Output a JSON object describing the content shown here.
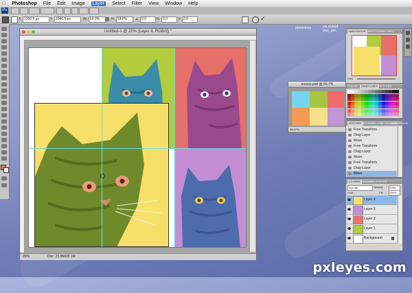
{
  "menubar": {
    "apple_icon": "apple-icon",
    "app": "Photoshop",
    "items": [
      "File",
      "Edit",
      "Image",
      "Layer",
      "Select",
      "Filter",
      "View",
      "Window",
      "Help"
    ],
    "active_item": "Layer"
  },
  "options_bar": {
    "x_value": "1250.5 px",
    "y_value": "2040.5 px",
    "w_value": "64.0%",
    "h_value": "64.0%",
    "angle_value": "0.0",
    "h_skew_value": "0.0",
    "v_skew_value": "0.0"
  },
  "desktop_labels": [
    "photoshop",
    "pw scaled",
    "pw1_stri..."
  ],
  "document": {
    "title": "Untitled-1 @ 25% (Layer 4, RGB/8) *",
    "zoom": "25%",
    "doc_info": "Doc: 25.8M/26.1M"
  },
  "source_window": {
    "title": "source.psd @ 66.7%",
    "zoom": "66.67%",
    "colors": [
      "#78d3f1",
      "#a7c443",
      "#f06a6a",
      "#f49a55",
      "#f5e08b",
      "#c394d6"
    ]
  },
  "navigator": {
    "tabs": [
      "NAVIGATOR",
      "HISTOGRAM",
      "INFO"
    ],
    "zoom": "25%"
  },
  "swatches": {
    "tabs": [
      "COLOR",
      "SWATCHES",
      "STYLES"
    ]
  },
  "history": {
    "tabs": [
      "HISTORY",
      "ACTIONS",
      "CLONE SOURCE",
      "ANIMATION"
    ],
    "items": [
      "Free Transform",
      "Drag Layer",
      "Move",
      "Free Transform",
      "Drag Layer",
      "Move",
      "Free Transform",
      "Drag Layer",
      "Move"
    ],
    "selected_index": 8
  },
  "layers": {
    "tabs": [
      "LAYERS",
      "CHANNELS",
      "PATHS"
    ],
    "blend_mode": "Normal",
    "opacity_label": "Opacity:",
    "opacity": "100%",
    "lock_label": "Lock:",
    "fill_label": "Fill:",
    "fill": "100%",
    "items": [
      {
        "name": "Layer 4",
        "color": "#f6e06a"
      },
      {
        "name": "Layer 3",
        "color": "#c48ed4"
      },
      {
        "name": "Layer 2",
        "color": "#f07070"
      },
      {
        "name": "Layer 1",
        "color": "#b2cc3e"
      },
      {
        "name": "Background",
        "color": "#ffffff"
      }
    ],
    "selected_index": 0
  },
  "watermark": "pxleyes.com",
  "colors": {
    "yellow_tile": "#f6e06a",
    "green_tile": "#b2cc3e",
    "red_tile": "#e8706a",
    "purple_tile": "#c48ed4",
    "cat_yellow_fg": "#6f8a2a",
    "cat_green_fg": "#3a8ca8",
    "cat_red_fg": "#9a4a8c",
    "cat_purple_fg": "#4d6cae",
    "guide": "#5fe0e8"
  }
}
